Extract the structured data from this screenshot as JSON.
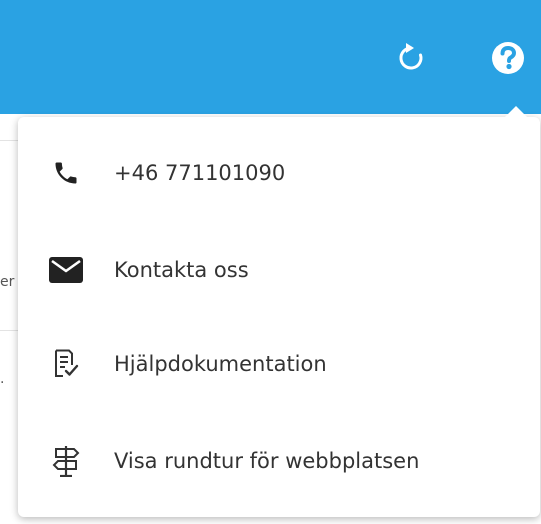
{
  "topbar": {
    "refresh_icon": "refresh-icon",
    "help_icon": "question-circle-icon",
    "background_color": "#2aa2e3"
  },
  "background_fragments": {
    "frag1": "er",
    "frag2": "."
  },
  "help_menu": {
    "items": [
      {
        "label": "+46 771101090",
        "icon": "phone-icon"
      },
      {
        "label": "Kontakta oss",
        "icon": "envelope-icon"
      },
      {
        "label": "Hjälpdokumentation",
        "icon": "document-check-icon"
      },
      {
        "label": "Visa rundtur för webbplatsen",
        "icon": "signpost-icon"
      }
    ]
  }
}
